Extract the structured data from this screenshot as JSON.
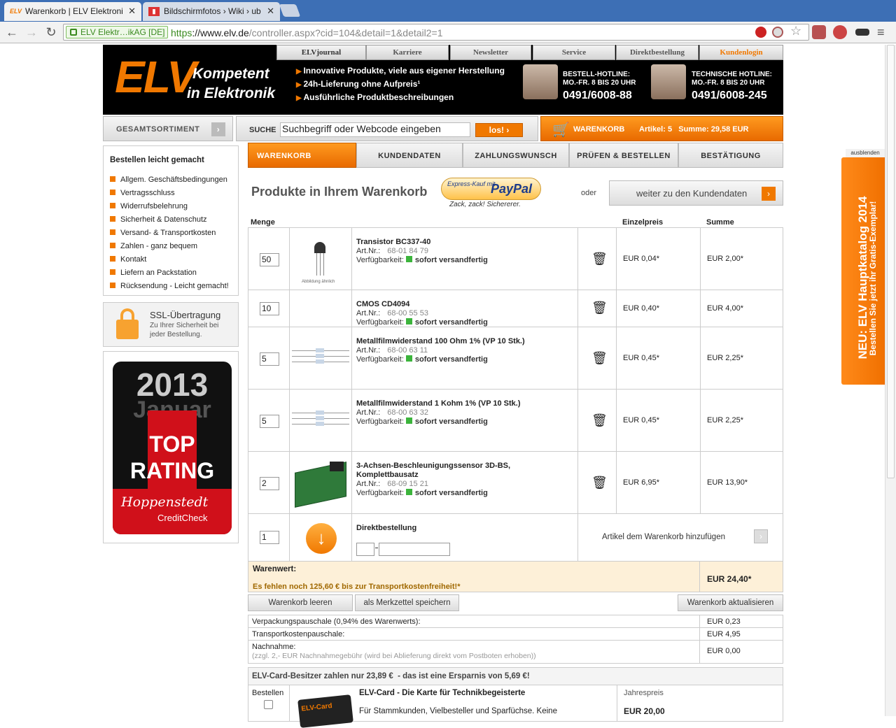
{
  "browser": {
    "tabs": [
      {
        "favicon": "ELV",
        "label": "Warenkorb | ELV Elektroni"
      },
      {
        "label": "Bildschirmfotos › Wiki › ub"
      }
    ],
    "ssl_label": "ELV Elektr…ikAG [DE]",
    "url_scheme": "https",
    "url_host": "://www.elv.de",
    "url_path": "/controller.aspx?cid=104&detail=1&detail2=1"
  },
  "header": {
    "logo": "ELV",
    "slogan_line1": "Kompetent",
    "slogan_line2": "in Elektronik",
    "benefits": [
      "Innovative Produkte, viele aus eigener Herstellung",
      "24h-Lieferung ohne Aufpreis¹",
      "Ausführliche Produktbeschreibungen"
    ],
    "nav": [
      "ELVjournal",
      "Karriere",
      "Newsletter",
      "Service",
      "Direktbestellung",
      "Kundenlogin"
    ],
    "hotline1": {
      "title": "BESTELL-HOTLINE:",
      "hours": "MO.-FR. 8 BIS 20 UHR",
      "number": "0491/6008-88"
    },
    "hotline2": {
      "title": "TECHNISCHE HOTLINE:",
      "hours": "MO.-FR. 8 BIS 20 UHR",
      "number": "0491/6008-245"
    }
  },
  "bar": {
    "gesamt": "GESAMTSORTIMENT",
    "suche_label": "SUCHE",
    "suche_value": "Suchbegriff oder Webcode eingeben",
    "los": "los!",
    "cart_label": "WARENKORB",
    "cart_info": "Artikel: 5   Summe: 29,58 EUR"
  },
  "sidebar": {
    "title": "Bestellen leicht gemacht",
    "links": [
      "Allgem. Geschäftsbedingungen",
      "Vertragsschluss",
      "Widerrufsbelehrung",
      "Sicherheit & Datenschutz",
      "Versand- & Transportkosten",
      "Zahlen - ganz bequem",
      "Kontakt",
      "Liefern an Packstation",
      "Rücksendung - Leicht gemacht!"
    ],
    "ssl_title": "SSL-Übertragung",
    "ssl_text1": "Zu Ihrer Sicherheit bei",
    "ssl_text2": "jeder Bestellung.",
    "badge_year": "2013",
    "badge_month": "Januar",
    "badge_top": "TOP",
    "badge_rating": "RATING",
    "badge_brand": "Hoppenstedt",
    "badge_check": "CreditCheck"
  },
  "steps": [
    "WARENKORB",
    "KUNDENDATEN",
    "ZAHLUNGSWUNSCH",
    "PRÜFEN & BESTELLEN",
    "BESTÄTIGUNG"
  ],
  "cart": {
    "title": "Produkte in Ihrem Warenkorb",
    "paypal_top": "Express-Kauf mit",
    "paypal_logo": "PayPal",
    "paypal_tag": "Zack, zack! Sichererer.",
    "oder": "oder",
    "weiter": "weiter zu den Kundendaten",
    "col_menge": "Menge",
    "col_einzel": "Einzelpreis",
    "col_summe": "Summe",
    "artnr_label": "Art.Nr.:",
    "avail_label": "Verfügbarkeit:",
    "thumb_note": "Abbildung ähnlich",
    "items": [
      {
        "qty": "50",
        "name": "Transistor BC337-40",
        "name2": "",
        "artnr": "68-01 84 79",
        "avail": "sofort versandfertig",
        "price": "EUR 0,04*",
        "sum": "EUR 2,00*"
      },
      {
        "qty": "10",
        "name": "CMOS CD4094",
        "name2": "",
        "artnr": "68-00 55 53",
        "avail": "sofort versandfertig",
        "price": "EUR 0,40*",
        "sum": "EUR 4,00*"
      },
      {
        "qty": "5",
        "name": "Metallfilmwiderstand 100 Ohm 1% (VP 10 Stk.)",
        "name2": "",
        "artnr": "68-00 63 11",
        "avail": "sofort versandfertig",
        "price": "EUR 0,45*",
        "sum": "EUR 2,25*"
      },
      {
        "qty": "5",
        "name": "Metallfilmwiderstand 1 Kohm 1% (VP 10 Stk.)",
        "name2": "",
        "artnr": "68-00 63 32",
        "avail": "sofort versandfertig",
        "price": "EUR 0,45*",
        "sum": "EUR 2,25*"
      },
      {
        "qty": "2",
        "name": "3-Achsen-Beschleunigungssensor 3D-BS,",
        "name2": "Komplettbausatz",
        "artnr": "68-09 15 21",
        "avail": "sofort versandfertig",
        "price": "EUR 6,95*",
        "sum": "EUR 13,90*"
      }
    ],
    "direkt_qty": "1",
    "direkt_label": "Direktbestellung",
    "direkt_add": "Artikel dem Warenkorb hinzufügen",
    "warenwert_label": "Warenwert:",
    "warenwert_value": "EUR 24,40*",
    "missing": "Es fehlen noch 125,60 € bis zur Transportkostenfreiheit!*",
    "btn_clear": "Warenkorb leeren",
    "btn_save": "als Merkzettel speichern",
    "btn_update": "Warenkorb aktualisieren",
    "costs": [
      {
        "label": "Verpackungspauschale (0,94% des Warenwerts):",
        "value": "EUR 0,23"
      },
      {
        "label": "Transportkostenpauschale:",
        "value": "EUR 4,95"
      },
      {
        "label": "Nachnahme:",
        "value": "EUR 0,00"
      }
    ],
    "nachnahme_note": "(zzgl. 2,- EUR Nachnahmegebühr (wird bei Ablieferung direkt vom Postboten erhoben))",
    "card_banner": "ELV-Card-Besitzer zahlen nur 23,89 €  - das ist eine Ersparnis von 5,69 €!",
    "card_bestellen": "Bestellen",
    "card_img_text": "ELV-Card",
    "card_name": "ELV-Card - Die Karte für Technikbegeisterte",
    "card_desc": "Für Stammkunden, Vielbesteller und Sparfüchse. Keine",
    "card_price_label": "Jahrespreis",
    "card_price": "EUR 20,00"
  },
  "promo": {
    "hide": "ausblenden",
    "line1": "NEU: ELV Hauptkatalog 2014",
    "line2": "Bestellen Sie jetzt ihr Gratis-Exemplar!"
  },
  "colors": {
    "accent": "#f07800",
    "tabbar": "#3d6fb5",
    "available": "#3cb43c"
  }
}
